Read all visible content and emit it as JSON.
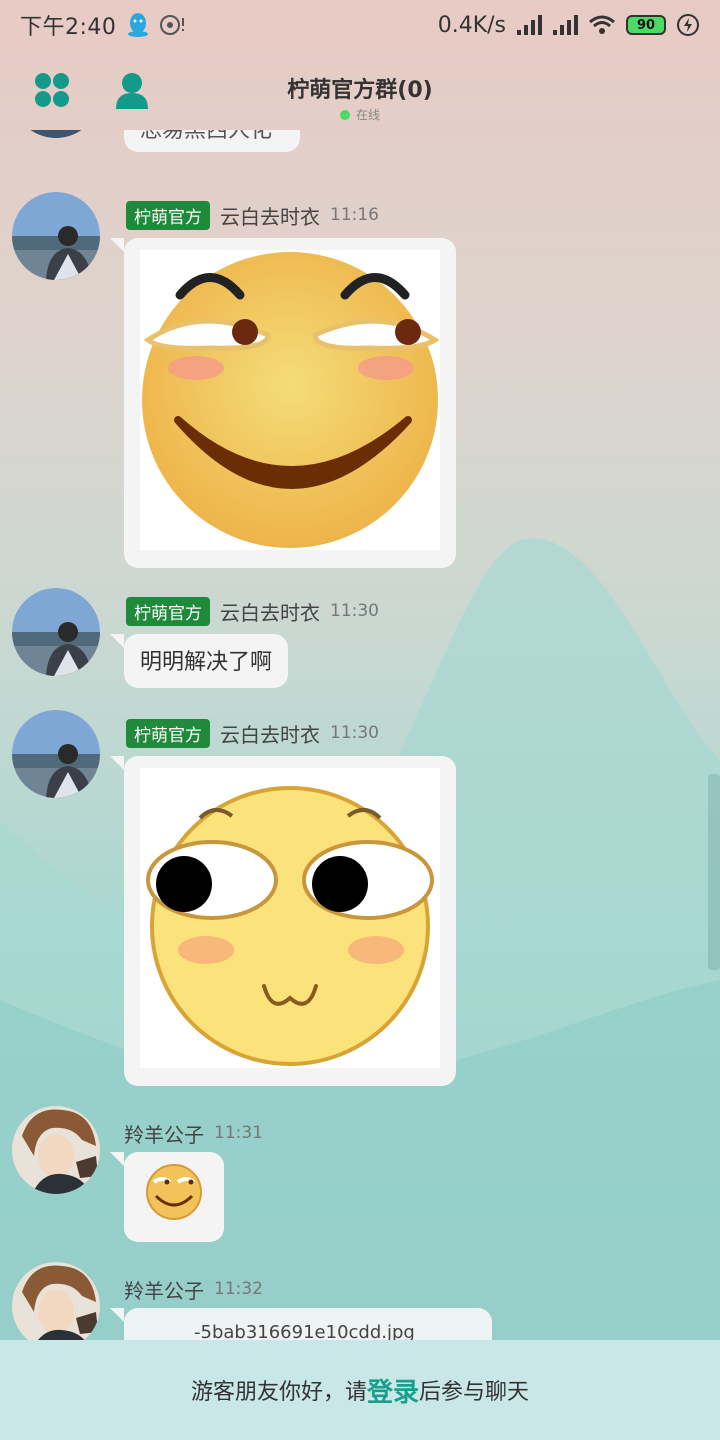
{
  "status_bar": {
    "time": "下午2:40",
    "net_speed": "0.4K/s",
    "battery": "90",
    "icons": [
      "qq-icon",
      "media-icon",
      "signal-icon",
      "signal-icon",
      "wifi-icon",
      "battery-icon",
      "charging-icon"
    ]
  },
  "header": {
    "title": "柠萌官方群",
    "member_count": "(0)",
    "status": "在线",
    "left_icons": [
      "menu-grid-icon",
      "user-icon"
    ],
    "accent": "#149a8a"
  },
  "messages": [
    {
      "kind": "text-partial",
      "text": "恐易黑西人化"
    },
    {
      "tag": "柠萌官方",
      "nick": "云白去时衣",
      "time": "11:16",
      "kind": "image",
      "content": "smirk-emoji"
    },
    {
      "tag": "柠萌官方",
      "nick": "云白去时衣",
      "time": "11:30",
      "kind": "text",
      "text": "明明解决了啊"
    },
    {
      "tag": "柠萌官方",
      "nick": "云白去时衣",
      "time": "11:30",
      "kind": "image",
      "content": "cute-emoji"
    },
    {
      "nick": "羚羊公子",
      "time": "11:31",
      "kind": "small-emoji",
      "content": "smirk-small-emoji"
    },
    {
      "nick": "羚羊公子",
      "time": "11:32",
      "kind": "file",
      "text": "-5bab316691e10cdd.jpg"
    }
  ],
  "footer": {
    "prefix": "游客朋友你好，请",
    "login": "登录",
    "suffix": "后参与聊天",
    "login_color": "#1a9e8e"
  },
  "tag_color": "#1e8a3a"
}
